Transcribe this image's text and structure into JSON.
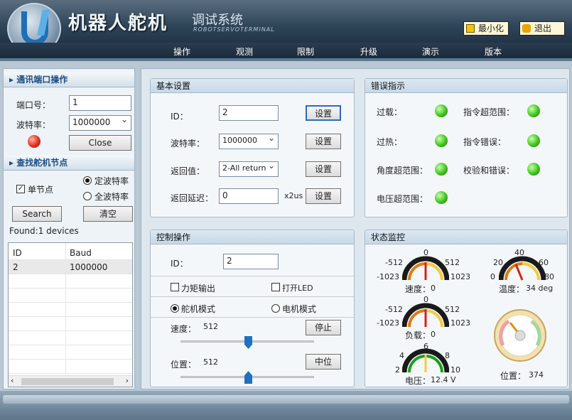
{
  "header": {
    "title": "机器人舵机",
    "subtitle": "调试系统",
    "subtitle_en": "ROBOTSERVOTERMINAL",
    "minimize": "最小化",
    "exit": "退出"
  },
  "nav": [
    "操作",
    "观测",
    "限制",
    "升级",
    "演示",
    "版本"
  ],
  "comm": {
    "heading": "通讯端口操作",
    "port_label": "端口号：",
    "port_value": "1",
    "baud_label": "波特率：",
    "baud_value": "1000000",
    "close": "Close"
  },
  "find": {
    "heading": "查找舵机节点",
    "single": "单节点",
    "fixed_baud": "定波特率",
    "all_baud": "全波特率",
    "search": "Search",
    "clear": "清空",
    "found": "Found:1 devices",
    "columns": [
      "ID",
      "Baud"
    ],
    "rows": [
      {
        "id": "2",
        "baud": "1000000"
      }
    ]
  },
  "basic": {
    "heading": "基本设置",
    "id_label": "ID：",
    "id_value": "2",
    "baud_label": "波特率：",
    "baud_value": "1000000",
    "return_label": "返回值：",
    "return_value": "2-All return",
    "delay_label": "返回延迟：",
    "delay_value": "0",
    "delay_unit": "x2us",
    "set": "设置"
  },
  "errors": {
    "heading": "错误指示",
    "overload": "过载：",
    "cmd_range": "指令超范围：",
    "overheat": "过热：",
    "cmd_error": "指令错误：",
    "angle_range": "角度超范围：",
    "checksum": "校验和错误：",
    "voltage_range": "电压超范围："
  },
  "control": {
    "heading": "控制操作",
    "id_label": "ID：",
    "id_value": "2",
    "torque": "力矩输出",
    "led": "打开LED",
    "servo_mode": "舵机模式",
    "motor_mode": "电机模式",
    "speed_label": "速度：",
    "speed_value": "512",
    "stop": "停止",
    "pos_label": "位置：",
    "pos_value": "512",
    "center": "中位"
  },
  "monitor": {
    "heading": "状态监控",
    "speed_label": "速度：",
    "speed_value": "0",
    "speed_ticks": [
      "-512",
      "0",
      "512",
      "-1023",
      "1023"
    ],
    "temp_label": "温度：",
    "temp_value": "34 deg",
    "temp_ticks": [
      "20",
      "40",
      "60",
      "0",
      "80"
    ],
    "load_label": "负载：",
    "load_value": "0",
    "load_ticks": [
      "-512",
      "0",
      "512",
      "-1023",
      "1023"
    ],
    "volt_label": "电压：",
    "volt_value": "12.4 V",
    "volt_ticks": [
      "4",
      "6",
      "8",
      "2",
      "10"
    ],
    "pos_label": "位置：",
    "pos_value": "374"
  }
}
